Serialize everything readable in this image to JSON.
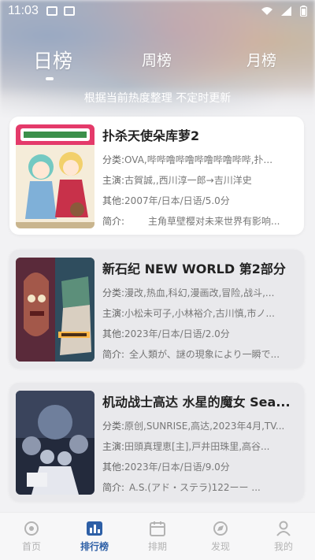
{
  "status_bar": {
    "time": "11:03"
  },
  "rank_tabs": [
    {
      "label": "日榜",
      "active": true
    },
    {
      "label": "周榜",
      "active": false
    },
    {
      "label": "月榜",
      "active": false
    }
  ],
  "subtitle": "根据当前热度整理 不定时更新",
  "cards": [
    {
      "title": "扑杀天使朵库萝2",
      "genre_label": "分类:",
      "genre": "OVA,哔哔噜哔噜哔噜哔噜哔哔,扑...",
      "cast_label": "主演:",
      "cast": "古賀誠,,西川淳一郎→吉川洋史",
      "other_label": "其他:",
      "other": "2007年/日本/日语/5.0分",
      "intro_label": "简介:",
      "intro": "主角草壁樱对未来世界有影响..."
    },
    {
      "title": "新石纪 NEW WORLD 第2部分",
      "genre_label": "分类:",
      "genre": "漫改,热血,科幻,漫画改,冒险,战斗,...",
      "cast_label": "主演:",
      "cast": "小松未可子,小林裕介,古川慎,市ノ...",
      "other_label": "其他:",
      "other": "2023年/日本/日语/2.0分",
      "intro_label": "简介:",
      "intro": "全人類が、謎の現象により一瞬で..."
    },
    {
      "title": "机动战士高达 水星的魔女 Sea...",
      "genre_label": "分类:",
      "genre": "原创,SUNRISE,高达,2023年4月,TV...",
      "cast_label": "主演:",
      "cast": "田頭真理恵[主],戸井田珠里,高谷...",
      "other_label": "其他:",
      "other": "2023年/日本/日语/9.0分",
      "intro_label": "简介:",
      "intro": "A.S.(アド・ステラ)122ーー ..."
    }
  ],
  "bottom_nav": [
    {
      "label": "首页",
      "icon": "home-icon",
      "active": false
    },
    {
      "label": "排行榜",
      "icon": "ranking-icon",
      "active": true
    },
    {
      "label": "排期",
      "icon": "calendar-icon",
      "active": false
    },
    {
      "label": "发现",
      "icon": "discover-icon",
      "active": false
    },
    {
      "label": "我的",
      "icon": "profile-icon",
      "active": false
    }
  ],
  "colors": {
    "accent": "#2d5fa6",
    "inactive_nav": "#b3b3b3",
    "background": "#f2f2f4"
  }
}
